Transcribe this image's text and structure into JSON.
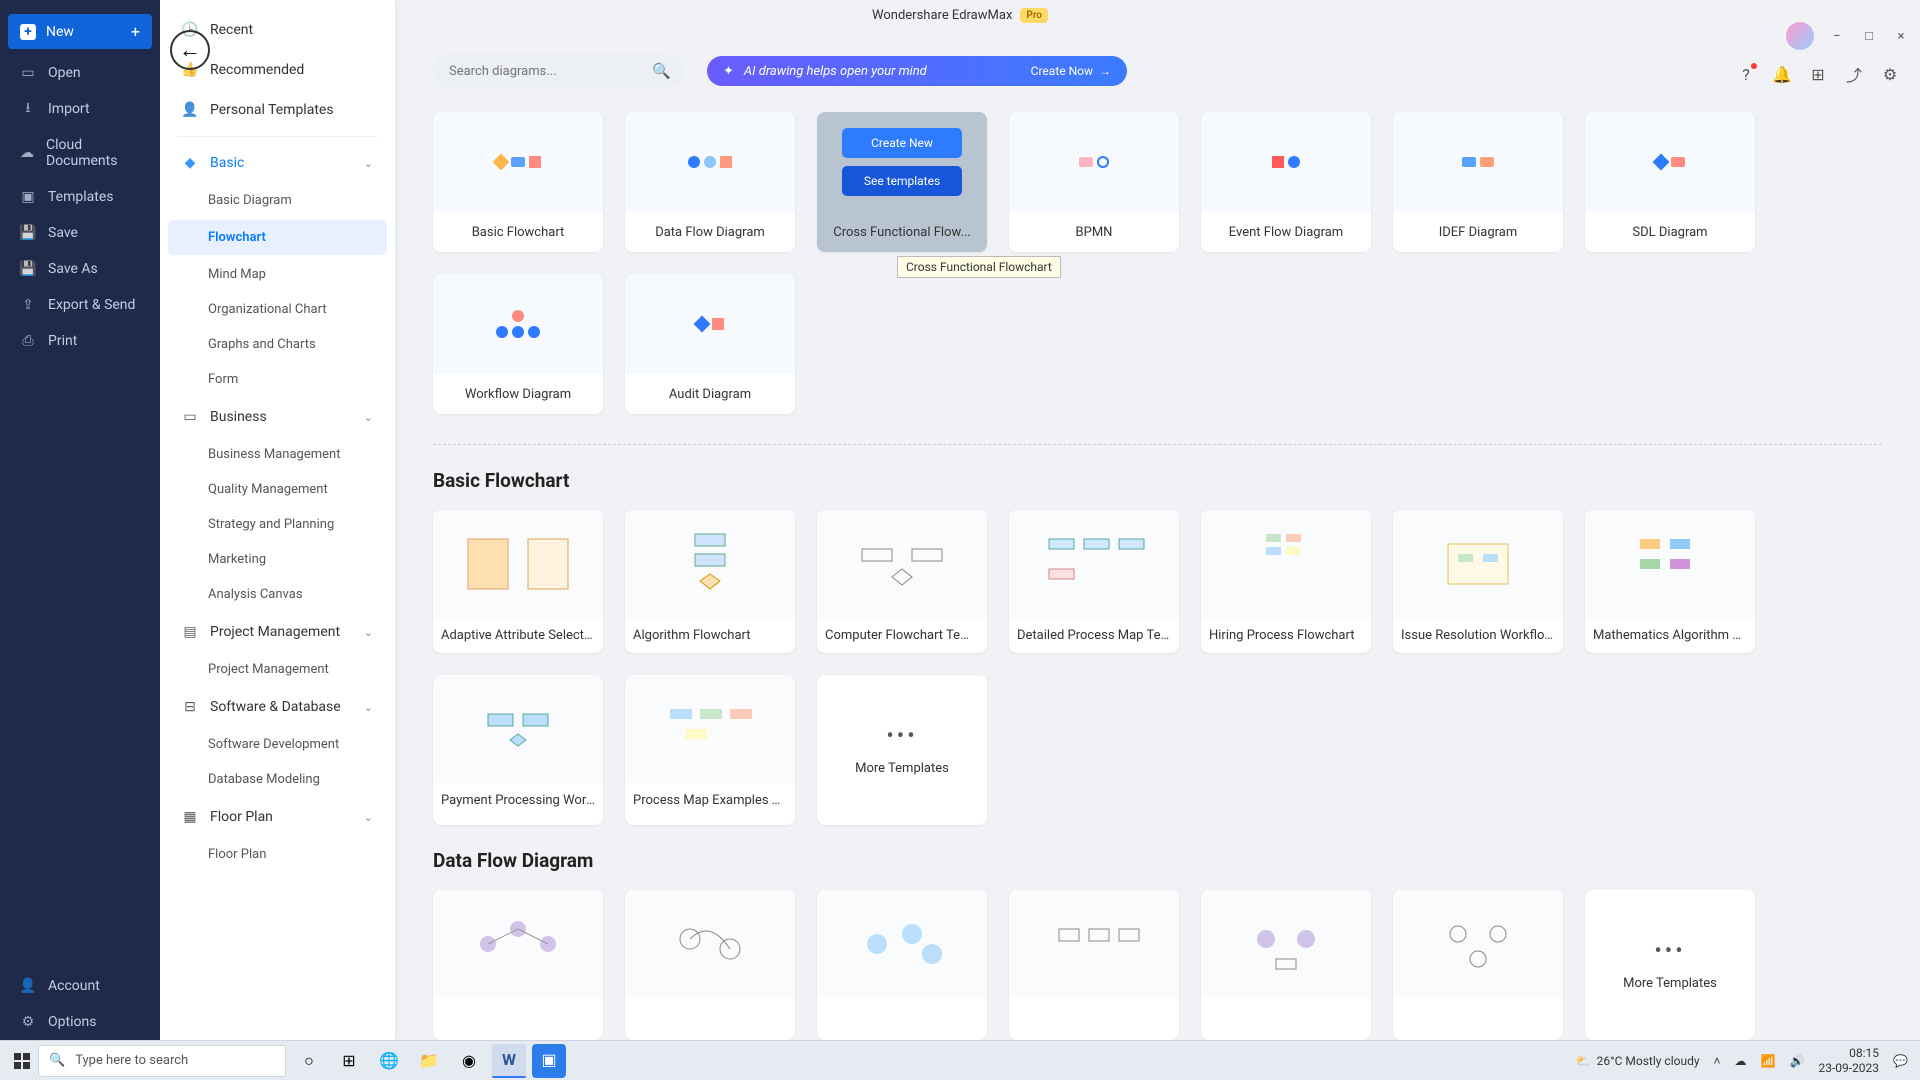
{
  "app": {
    "title": "Wondershare EdrawMax",
    "badge": "Pro"
  },
  "window_controls": {
    "min": "−",
    "max": "□",
    "close": "×"
  },
  "leftRail": {
    "new": "New",
    "open": "Open",
    "import": "Import",
    "cloud": "Cloud Documents",
    "templates": "Templates",
    "save": "Save",
    "saveAs": "Save As",
    "export": "Export & Send",
    "print": "Print",
    "account": "Account",
    "options": "Options"
  },
  "midPanel": {
    "recent": "Recent",
    "recommended": "Recommended",
    "personal": "Personal Templates",
    "basic": {
      "head": "Basic",
      "items": {
        "bd": "Basic Diagram",
        "fc": "Flowchart",
        "mm": "Mind Map",
        "oc": "Organizational Chart",
        "gc": "Graphs and Charts",
        "fm": "Form"
      }
    },
    "business": {
      "head": "Business",
      "items": {
        "bm": "Business Management",
        "qm": "Quality Management",
        "sp": "Strategy and Planning",
        "mk": "Marketing",
        "ac": "Analysis Canvas"
      }
    },
    "pm": {
      "head": "Project Management",
      "items": {
        "pm1": "Project Management"
      }
    },
    "sd": {
      "head": "Software & Database",
      "items": {
        "sd1": "Software Development",
        "sd2": "Database Modeling"
      }
    },
    "fp": {
      "head": "Floor Plan",
      "items": {
        "fp1": "Floor Plan"
      }
    }
  },
  "search": {
    "placeholder": "Search diagrams..."
  },
  "aiBanner": {
    "text": "AI drawing helps open your mind",
    "cta": "Create Now"
  },
  "typeCards": {
    "basicFlowchart": "Basic Flowchart",
    "dataFlow": "Data Flow Diagram",
    "crossFunc": "Cross Functional Flow...",
    "crossFuncFull": "Cross Functional Flowchart",
    "createNew": "Create New",
    "seeTemplates": "See templates",
    "bpmn": "BPMN",
    "eventFlow": "Event Flow Diagram",
    "idef": "IDEF Diagram",
    "sdl": "SDL Diagram",
    "workflow": "Workflow Diagram",
    "audit": "Audit Diagram"
  },
  "sections": {
    "basicFlowchart": {
      "title": "Basic Flowchart",
      "templates": {
        "t1": "Adaptive Attribute Selectio...",
        "t2": "Algorithm Flowchart",
        "t3": "Computer Flowchart Temp...",
        "t4": "Detailed Process Map Tem...",
        "t5": "Hiring Process Flowchart",
        "t6": "Issue Resolution Workflow ...",
        "t7": "Mathematics Algorithm Fl...",
        "t8": "Payment Processing Workf...",
        "t9": "Process Map Examples Te...",
        "more": "More Templates"
      }
    },
    "dataFlow": {
      "title": "Data Flow Diagram",
      "more": "More Templates"
    }
  },
  "taskbar": {
    "searchPlaceholder": "Type here to search",
    "weather": "26°C  Mostly cloudy",
    "time": "08:15",
    "date": "23-09-2023"
  }
}
